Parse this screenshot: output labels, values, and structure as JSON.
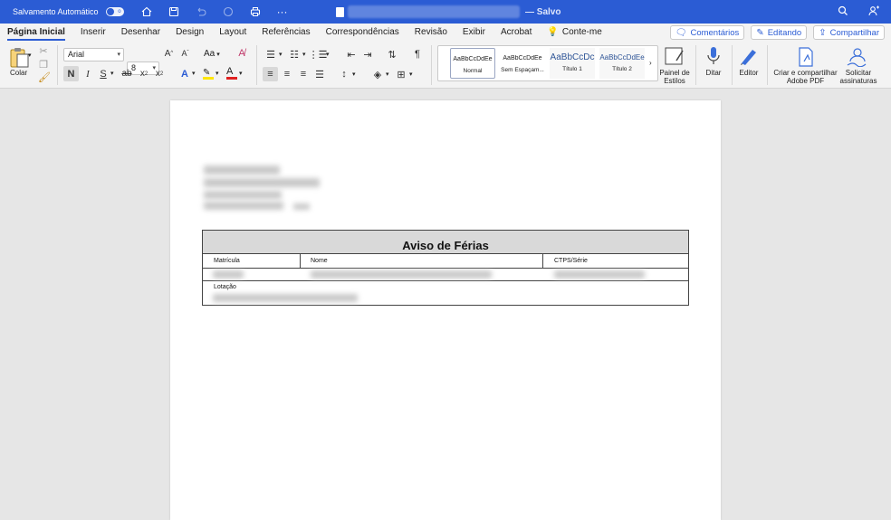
{
  "titlebar": {
    "autosave_label": "Salvamento Automático",
    "autosave_state": "o",
    "saved_status": "— Salvo",
    "icons": [
      "home-icon",
      "save-icon",
      "undo-icon",
      "redo-icon",
      "print-icon",
      "more-icon",
      "search-icon",
      "share-icon"
    ]
  },
  "tabs": [
    "Página Inicial",
    "Inserir",
    "Desenhar",
    "Design",
    "Layout",
    "Referências",
    "Correspondências",
    "Revisão",
    "Exibir",
    "Acrobat",
    "Conte-me"
  ],
  "tab_actions": {
    "comments": "Comentários",
    "editing": "Editando",
    "share": "Compartilhar"
  },
  "ribbon": {
    "paste_label": "Colar",
    "font_name": "Arial",
    "font_size": "8",
    "bold": "N",
    "italic": "I",
    "underline": "S",
    "strike": "ab",
    "change_case": "Aa",
    "styles": [
      {
        "sample": "AaBbCcDdEe",
        "name": "Normal"
      },
      {
        "sample": "AaBbCcDdEe",
        "name": "Sem Espaçam..."
      },
      {
        "sample": "AaBbCcDc",
        "name": "Título 1"
      },
      {
        "sample": "AaBbCcDdEe",
        "name": "Título 2"
      }
    ],
    "styles_pane_label": "Painel de Estilos",
    "dictate_label": "Ditar",
    "editor_label": "Editor",
    "create_pdf_label": "Criar e compartilhar Adobe PDF",
    "request_sign_label": "Solicitar assinaturas"
  },
  "document": {
    "table_title": "Aviso de Férias",
    "col_matricula": "Matrícula",
    "col_nome": "Nome",
    "col_ctps": "CTPS/Série",
    "row_lotacao": "Lotação"
  },
  "colors": {
    "accent": "#2b5cd4",
    "highlight": "#ffe600",
    "font_color": "#e02020"
  }
}
